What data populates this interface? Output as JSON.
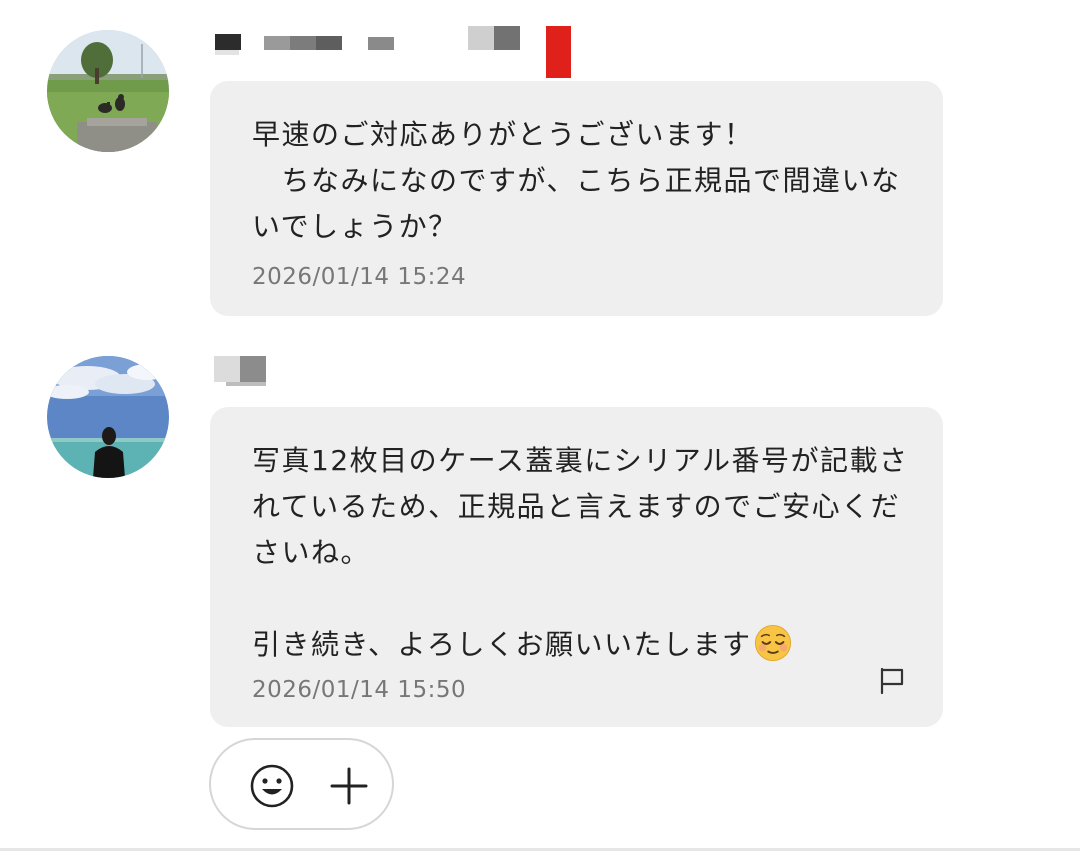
{
  "messages": [
    {
      "sender_name_redacted": true,
      "text": "早速のご対応ありがとうございます！\n　ちなみになのですが、こちら正規品で間違いないでしょうか？",
      "timestamp": "2026/01/14 15:24"
    },
    {
      "sender_name_redacted": true,
      "text": "写真12枚目のケース蓋裏にシリアル番号が記載されているため、正規品と言えますのでご安心くださいね。\n\n引き続き、よろしくお願いいたします",
      "emoji": "relieved-face",
      "timestamp": "2026/01/14 15:50",
      "report_icon": "flag-icon"
    }
  ],
  "composer": {
    "buttons": [
      "smiley-face-icon",
      "plus-icon"
    ]
  },
  "colors": {
    "bubble_bg": "#efefef",
    "text": "#222222",
    "timestamp": "#777777",
    "redaction_red": "#e0201a"
  }
}
